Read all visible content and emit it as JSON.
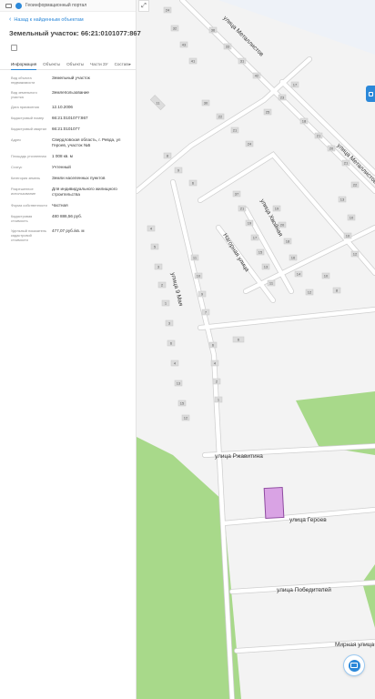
{
  "header": {
    "portal_title": "Геоинформационный портал",
    "back_link": "Назад к найденным объектам"
  },
  "parcel": {
    "title": "Земельный участок: 66:21:0101077:867"
  },
  "tabs": [
    "Информация",
    "Объекты",
    "Объекты",
    "Части ЗУ",
    "Состав"
  ],
  "properties": [
    {
      "key": "Вид объекта недвижимости",
      "value": "Земельный участок"
    },
    {
      "key": "Вид земельного участка",
      "value": "Землепользование"
    },
    {
      "key": "Дата присвоения",
      "value": "12.10.2006"
    },
    {
      "key": "Кадастровый номер",
      "value": "66:21:0101077:867"
    },
    {
      "key": "Кадастровый квартал",
      "value": "66:21:0101077"
    },
    {
      "key": "Адрес",
      "value": "Свердловская область, г. Ревда, ул Героев, участок №5"
    },
    {
      "key": "Площадь уточненная",
      "value": "1 008 кв. м"
    },
    {
      "key": "Статус",
      "value": "Учтенный"
    },
    {
      "key": "Категория земель",
      "value": "Земли населенных пунктов"
    },
    {
      "key": "Разрешенное использование",
      "value": "Для индивидуального жилищного строительства"
    },
    {
      "key": "Форма собственности",
      "value": "Частная"
    },
    {
      "key": "Кадастровая стоимость",
      "value": "480 886,56 руб."
    },
    {
      "key": "Удельный показатель кадастровой стоимости",
      "value": "477,07 руб./кв. м"
    }
  ],
  "map": {
    "streets": {
      "metallistov_top": "улица Металлистов",
      "metallistov_right": "улица Металлистов",
      "khvoynaya": "улица Хвойная",
      "nagornaya": "Нагорная улица",
      "sverdlova": "улица 9 Мая",
      "rzhavitina": "улица Ржавитина",
      "geroev": "улица Героев",
      "pobediteley": "улица Победителей",
      "mirnaya": "Мирная улица"
    },
    "house_numbers": [
      "24",
      "32",
      "43",
      "41",
      "36",
      "33",
      "31",
      "42",
      "30",
      "22",
      "21",
      "24",
      "25",
      "23",
      "17",
      "18",
      "21",
      "20",
      "21",
      "22",
      "13",
      "10",
      "10",
      "12",
      "11",
      "8",
      "9",
      "6",
      "4",
      "5",
      "3",
      "2",
      "1",
      "3",
      "6",
      "4",
      "13",
      "15",
      "12",
      "11",
      "10",
      "9",
      "7",
      "6",
      "4",
      "2",
      "1",
      "37",
      "21",
      "19",
      "17",
      "15",
      "13",
      "11",
      "19",
      "20",
      "18",
      "16",
      "14",
      "12",
      "10",
      "8",
      "6",
      "4",
      "12",
      "1",
      "4",
      "5",
      "8",
      "9",
      "17",
      "15",
      "11",
      "13",
      "101",
      "15",
      "16",
      "19",
      "21",
      "20",
      "26",
      "24",
      "23",
      "29",
      "27",
      "133",
      "26",
      "24",
      "32",
      "48",
      "41",
      "39",
      "37",
      "31",
      "31",
      "28",
      "9",
      "16",
      "18",
      "20",
      "30",
      "52",
      "48",
      "44",
      "44",
      "22",
      "5",
      "3"
    ],
    "colors": {
      "background": "#f3f3f3",
      "green": "#a8d98a",
      "road": "#ffffff",
      "building": "#dcdcdc",
      "parcel": "#d9a3e4",
      "accent": "#2b88d9"
    }
  }
}
